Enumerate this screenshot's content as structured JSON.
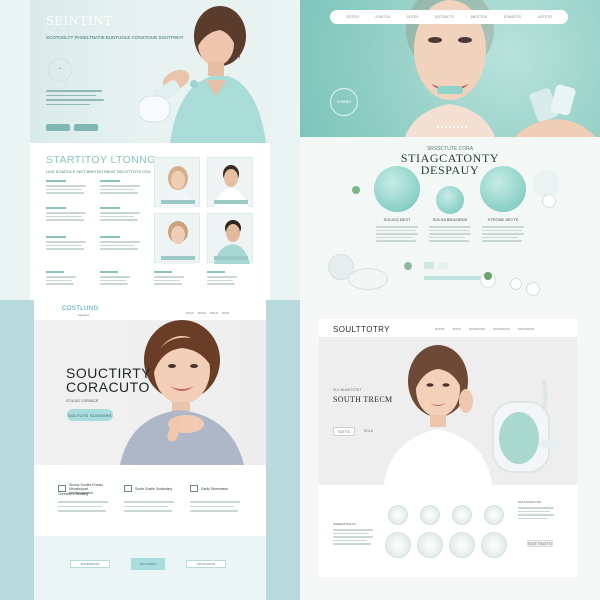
{
  "panel1": {
    "hero_title": "SEINTINT",
    "hero_sub": "SCOTOOLTY PHSELTNATIE EUNTUOLE CONSTOUR SOUTPWAT",
    "hero_icon": "chevron-up-icon",
    "section_title": "STARTITOY LTONNG",
    "section_sub": "LIKE SOMTOLE INCT BIER BOTNEAT SECOTTOTS CRA"
  },
  "panel2": {
    "nav_items": [
      "SOTOO",
      "SONTOS",
      "SOTES",
      "SOTSACTS",
      "ABOTTOS",
      "SOMSOTS",
      "SOTETS"
    ],
    "hero_badge": "SOSNES",
    "section_kicker": "SRSSCTUTE CORA",
    "section_title_1": "STIAGCATONTY",
    "section_title_2": "DESPAUY",
    "captions": [
      "SOLIGG BEST",
      "SOLSA BRASIRNS",
      "STRONE SEYTE"
    ]
  },
  "panel3": {
    "logo": "COSTLUNG",
    "logo_sub": "sattuoss",
    "nav_items": [
      "STAS",
      "SOAS",
      "SOLS",
      "SOSI"
    ],
    "title_1": "SOUCTIRTY",
    "title_2": "CORACUTO",
    "tagline": "STULSO CORSACE",
    "cta": "SOLTUTE SLEASIRS",
    "features": [
      {
        "title": "Slomiy Soutes Enetsy Mhosieopart etrintarpayation"
      },
      {
        "title": "Sonte Snaile Ssdteatiny"
      },
      {
        "title": "Sartly Stsenatsss"
      }
    ],
    "footer_buttons": [
      "SOTENOOTS",
      "SAUTRONS",
      "SOTSLOOTS"
    ],
    "feature_extra": "Chrestorre Bsnsizg"
  },
  "panel4": {
    "logo": "SOULTTOTRY",
    "nav_items": [
      "SLSTS",
      "SOTS",
      "SCSFTONS",
      "SOTGRGTS",
      "SOSTSOTS"
    ],
    "kicker": "SLS BLWSTOTET",
    "title": "SOUTH TRECM",
    "button": "SOTS",
    "link": "SCLS",
    "left_heading": "SOREGTSOLAS",
    "right_heading": "SOLTSOGS TOS",
    "small_button": "SOTTSOTS"
  },
  "colors": {
    "mint": "#86c6c2",
    "teal_button": "#7fb7b4",
    "cyan_pill": "#a8dcdd",
    "logo_blue": "#3a9eb0"
  }
}
